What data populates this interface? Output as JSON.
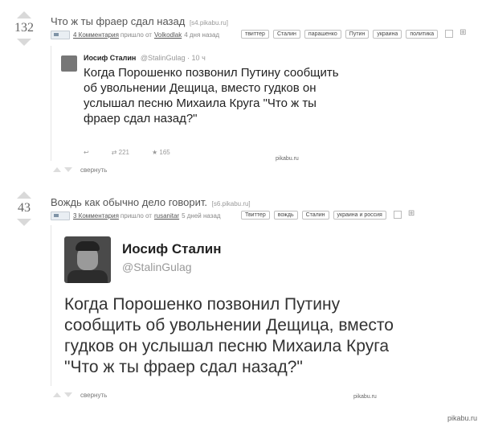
{
  "posts": [
    {
      "rating": "132",
      "title": "Что ж ты фраер сдал назад",
      "source": "[s4.pikabu.ru]",
      "comments": "4 Комментария",
      "posted_by": "пришло от",
      "user": "Volkodlak",
      "when": "4 дня назад",
      "tags": [
        "твиттер",
        "Сталин",
        "парашенко",
        "Путин",
        "украина",
        "политика"
      ],
      "collapse": "свернуть",
      "tweet": {
        "name": "Иосиф Сталин",
        "handle": "@StalinGulag · 10 ч",
        "text": "Когда Порошенко позвонил Путину сообщить об увольнении Дещица, вместо гудков он услышал песню Михаила Круга \"Что ж ты фраер сдал назад?\"",
        "retweets": "221",
        "favorites": "165"
      },
      "watermark": "pikabu.ru"
    },
    {
      "rating": "43",
      "title": "Вождь как обычно дело говорит.",
      "source": "[s6.pikabu.ru]",
      "comments": "3 Комментария",
      "posted_by": "пришло от",
      "user": "rusanitar",
      "when": "5 дней назад",
      "tags": [
        "Твиттер",
        "вождь",
        "Сталин",
        "украина и россия"
      ],
      "collapse": "свернуть",
      "tweet": {
        "name": "Иосиф Сталин",
        "handle": "@StalinGulag",
        "text": "Когда Порошенко позвонил Путину сообщить об увольнении Дещица, вместо гудков он услышал песню Михаила Круга \"Что ж ты фраер сдал назад?\""
      },
      "watermark": "pikabu.ru"
    }
  ],
  "footer_logo": "pikabu.ru"
}
